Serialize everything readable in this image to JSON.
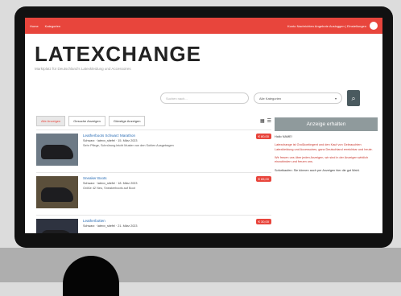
{
  "topnav": {
    "left": [
      "Home",
      "Kategorien"
    ],
    "right": "Konto Nachrichten Angebote Ausloggen | Einstellungen"
  },
  "brand": {
    "title": "LATEXCHANGE",
    "tagline": "Marktplatz für Deutschland's Latexkleidung und Accessoires"
  },
  "search": {
    "placeholder": "Suchen nach...",
    "category": "Alle Kategorien",
    "button_icon": "search-icon"
  },
  "tabs": [
    {
      "label": "Alle Anzeigen"
    },
    {
      "label": "Gesuche Anzeigen"
    },
    {
      "label": "Günstige Anzeigen"
    }
  ],
  "listings": [
    {
      "title": "Leatherboots Schwarz Marathon",
      "meta": "Schwarz · latexx_stiefel · 15. März 2023",
      "desc": "Sehr Pflege, Schnürung leicht Muster von den Sohlen Ausgetragen",
      "price": "€ 80,00"
    },
    {
      "title": "Sneaker Boots",
      "meta": "Schwarz · latexx_stiefel · 18. März 2023",
      "desc": "Größe 42 Neu, Sneakerboots auf Boot",
      "price": "€ 65,00"
    },
    {
      "title": "Leatherbotten",
      "meta": "Schwarz · latexx_stiefel · 21. März 2023",
      "desc": "",
      "price": "€ 30,00"
    }
  ],
  "sidebar": {
    "cta": "Anzeige erhalten",
    "intro": "Hallo NAME!",
    "para1": "Latexchange ist Großkontingent und den Kauf von Gebrauchten Latexkleidung und Accessoires, ganz Deutschland erreichbar und heute.",
    "para2": "Wir freuen uns über jeden Anzeigen, wir sind in der Anzeigen wirklich einzubinden und freuen uns.",
    "para3": "Sofortkaufen: Sie können auch per Anzeigen hier die gut Wahl."
  }
}
